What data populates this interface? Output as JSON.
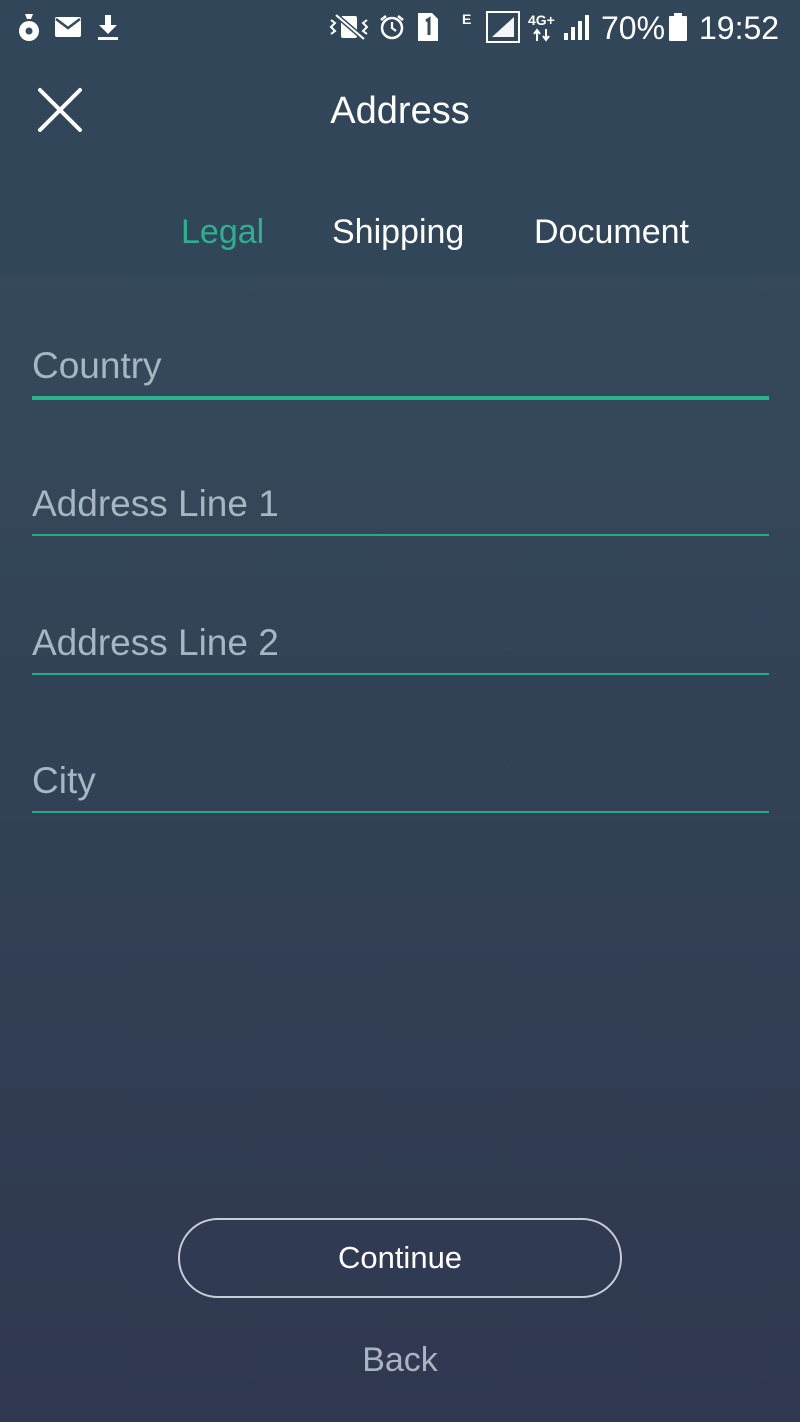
{
  "status_bar": {
    "icons_left": [
      "moneybag-icon",
      "mail-icon",
      "download-icon"
    ],
    "icons_right": [
      "vibrate-icon",
      "alarm-icon",
      "sim1-icon",
      "edge-network-icon",
      "signal-icon",
      "4g-icon",
      "signal-icon-2",
      "battery-icon"
    ],
    "network_e": "E",
    "network_4g": "4G+",
    "battery": "70%",
    "time": "19:52"
  },
  "header": {
    "title": "Address",
    "close_icon": "close-icon"
  },
  "tabs": [
    {
      "label": "Legal",
      "active": true
    },
    {
      "label": "Shipping",
      "active": false
    },
    {
      "label": "Document",
      "active": false
    }
  ],
  "form": {
    "country": {
      "placeholder": "Country",
      "value": ""
    },
    "address_line_1": {
      "placeholder": "Address Line 1",
      "value": ""
    },
    "address_line_2": {
      "placeholder": "Address Line 2",
      "value": ""
    },
    "city": {
      "placeholder": "City",
      "value": ""
    }
  },
  "actions": {
    "continue_label": "Continue",
    "back_label": "Back"
  },
  "colors": {
    "accent": "#2db08e",
    "header_bg": "#32465a",
    "placeholder": "#a7b6c3"
  }
}
